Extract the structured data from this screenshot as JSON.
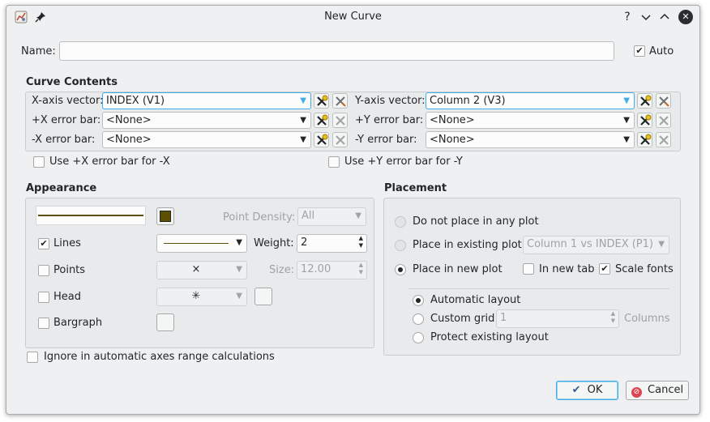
{
  "window": {
    "title": "New Curve",
    "help_label": "?",
    "min_label": "⌄",
    "max_label": "⌃",
    "close_label": "✕"
  },
  "name_row": {
    "label": "Name:",
    "value": "",
    "auto_label": "Auto",
    "auto_checked": true
  },
  "curve_contents": {
    "title": "Curve Contents",
    "x_vector_label": "X-axis vector:",
    "x_vector_value": "INDEX (V1)",
    "y_vector_label": "Y-axis vector:",
    "y_vector_value": "Column 2 (V3)",
    "plus_x_label": "+X error bar:",
    "plus_x_value": "<None>",
    "plus_y_label": "+Y error bar:",
    "plus_y_value": "<None>",
    "minus_x_label": "-X error bar:",
    "minus_x_value": "<None>",
    "minus_y_label": "-Y error bar:",
    "minus_y_value": "<None>",
    "use_x_label": "Use +X error bar for -X",
    "use_y_label": "Use +Y error bar for -Y"
  },
  "appearance": {
    "title": "Appearance",
    "line_color": "#5c5000",
    "point_density_label": "Point Density:",
    "point_density_value": "All",
    "lines_label": "Lines",
    "lines_checked": true,
    "weight_label": "Weight:",
    "weight_value": "2",
    "points_label": "Points",
    "point_symbol": "×",
    "size_label": "Size:",
    "size_value": "12.00",
    "head_label": "Head",
    "head_symbol": "✳",
    "bargraph_label": "Bargraph",
    "ignore_label": "Ignore in automatic axes range calculations"
  },
  "placement": {
    "title": "Placement",
    "no_place_label": "Do not place in any plot",
    "existing_label": "Place in existing plot",
    "existing_value": "Column 1 vs INDEX (P1)",
    "new_plot_label": "Place in new plot",
    "new_tab_label": "In new tab",
    "scale_fonts_label": "Scale fonts",
    "auto_layout_label": "Automatic layout",
    "custom_grid_label": "Custom grid",
    "custom_grid_value": "1",
    "columns_label": "Columns",
    "protect_label": "Protect existing layout"
  },
  "buttons": {
    "ok_label": "OK",
    "cancel_label": "Cancel"
  }
}
